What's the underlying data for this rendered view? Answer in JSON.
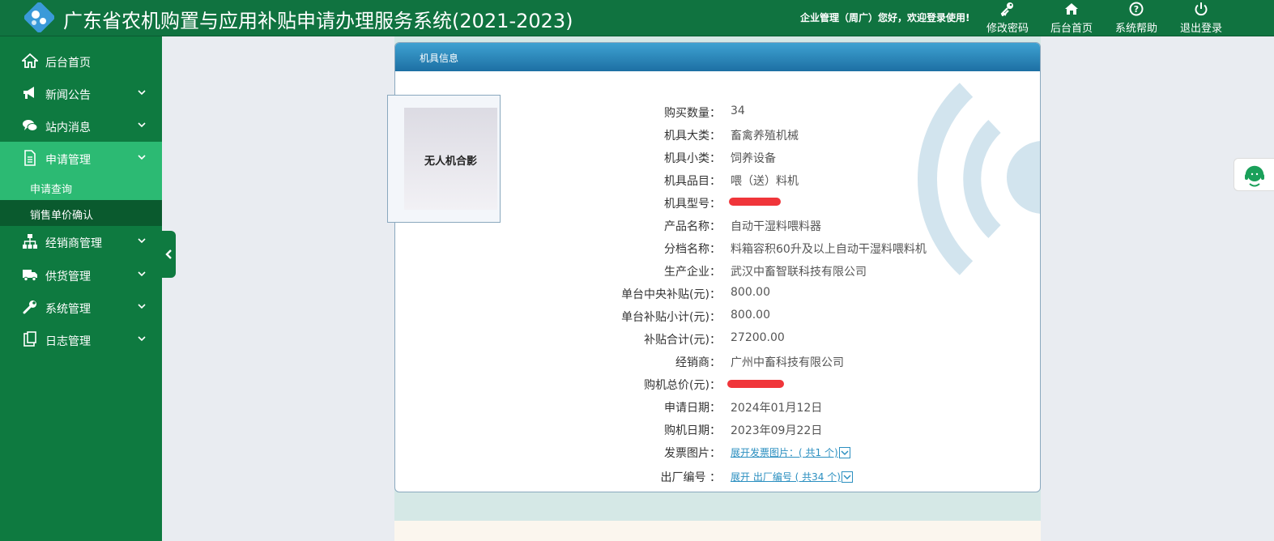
{
  "header": {
    "title": "广东省农机购置与应用补贴申请办理服务系统(2021-2023)",
    "welcome": "企业管理（周广）您好，欢迎登录使用!",
    "nav": [
      {
        "label": "修改密码",
        "icon": "key-icon"
      },
      {
        "label": "后台首页",
        "icon": "home-icon"
      },
      {
        "label": "系统帮助",
        "icon": "help-icon"
      },
      {
        "label": "退出登录",
        "icon": "power-icon"
      }
    ]
  },
  "sidebar": {
    "items": [
      {
        "label": "后台首页",
        "icon": "home-icon"
      },
      {
        "label": "新闻公告",
        "icon": "megaphone-icon"
      },
      {
        "label": "站内消息",
        "icon": "chat-icon"
      },
      {
        "label": "申请管理",
        "icon": "document-icon"
      },
      {
        "label": "经销商管理",
        "icon": "sitemap-icon"
      },
      {
        "label": "供货管理",
        "icon": "truck-icon"
      },
      {
        "label": "系统管理",
        "icon": "wrench-icon"
      },
      {
        "label": "日志管理",
        "icon": "clipboard-icon"
      }
    ],
    "sub_items": [
      {
        "label": "申请查询"
      },
      {
        "label": "销售单价确认"
      }
    ]
  },
  "panel": {
    "title": "机具信息",
    "photo_caption": "无人机合影",
    "fields": [
      {
        "label": "购买数量：",
        "value": "34"
      },
      {
        "label": "机具大类：",
        "value": "畜禽养殖机械"
      },
      {
        "label": "机具小类：",
        "value": "饲养设备"
      },
      {
        "label": "机具品目：",
        "value": "喂（送）料机"
      },
      {
        "label": "机具型号：",
        "value": ""
      },
      {
        "label": "产品名称：",
        "value": "自动干湿料喂料器"
      },
      {
        "label": "分档名称：",
        "value": "料箱容积60升及以上自动干湿料喂料机"
      },
      {
        "label": "生产企业：",
        "value": "武汉中畜智联科技有限公司"
      },
      {
        "label": "单台中央补贴(元)：",
        "value": "800.00"
      },
      {
        "label": "单台补贴小计(元)：",
        "value": "800.00"
      },
      {
        "label": "补贴合计(元)：",
        "value": "27200.00"
      },
      {
        "label": "经销商：",
        "value": "广州中畜科技有限公司"
      },
      {
        "label": "购机总价(元)：",
        "value": ""
      },
      {
        "label": "申请日期：",
        "value": "2024年01月12日"
      },
      {
        "label": "购机日期：",
        "value": "2023年09月22日"
      }
    ],
    "invoice": {
      "label": "发票图片：",
      "link": "展开发票图片：( 共1 个)"
    },
    "serial": {
      "label": "出厂编号 ：",
      "link": "展开 出厂编号 ( 共34 个)"
    }
  },
  "colors": {
    "header": "#107340",
    "sidebar": "#0e7a40",
    "active": "#2cba73",
    "panel_head": "#1d6fa3",
    "link": "#2b8fc0"
  }
}
